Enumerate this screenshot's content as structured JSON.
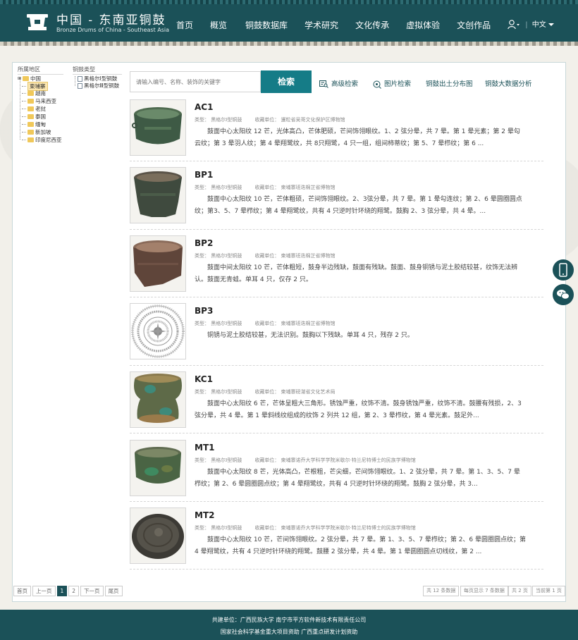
{
  "header": {
    "logo_cn": "中国 - 东南亚铜鼓",
    "logo_en": "Bronze Drums of China - Southeast Asia",
    "nav": [
      "首页",
      "概览",
      "铜鼓数据库",
      "学术研究",
      "文化传承",
      "虚拟体验",
      "文创作品"
    ],
    "lang": "中文"
  },
  "filters": {
    "region_title": "所属地区",
    "region_items": [
      {
        "label": "中国",
        "selected": false
      },
      {
        "label": "柬埔寨",
        "selected": true
      },
      {
        "label": "越南",
        "selected": false
      },
      {
        "label": "马来西亚",
        "selected": false
      },
      {
        "label": "老挝",
        "selected": false
      },
      {
        "label": "泰国",
        "selected": false
      },
      {
        "label": "缅甸",
        "selected": false
      },
      {
        "label": "新加坡",
        "selected": false
      },
      {
        "label": "印度尼西亚",
        "selected": false
      }
    ],
    "type_title": "铜鼓类型",
    "type_items": [
      "黑格尔Ⅰ型铜鼓",
      "黑格尔Ⅲ型铜鼓"
    ]
  },
  "search": {
    "placeholder": "请输入编号、名称、装饰的关键字",
    "button": "检索",
    "advanced": "高级检索",
    "image_search": "图片检索",
    "map": "铜鼓出土分布图",
    "bigdata": "铜鼓大数据分析"
  },
  "labels": {
    "type": "类型：",
    "collection": "收藏单位："
  },
  "results": [
    {
      "code": "AC1",
      "type": "黑格尔Ⅰ型铜鼓",
      "collection": "暹粒省吴哥文化保护区博物馆",
      "desc": "鼓面中心太阳纹 12 芒，光体高凸，芒体肥硕，芒间饰翎眼纹。1、2 弦分晕，共 7 晕。第 1 晕光素；第 2 晕勾云纹；第 3 晕羽人纹；第 4 晕翔鹭纹，共 8只翔鹭，4 只一组，组间柿蒂纹；第 5、7 晕栉纹；第 6 ..."
    },
    {
      "code": "BP1",
      "type": "黑格尔Ⅰ型铜鼓",
      "collection": "柬埔寨班迭棉芷省博物馆",
      "desc": "鼓面中心太阳纹 10 芒，芒体粗硕，芒间饰翎眼纹。2、3弦分晕，共 7 晕。第 1 晕勾连纹；第 2、6 晕圆圈圆点纹；第3、5、7 晕栉纹；第 4 晕翔鹭纹，共有 4 只逆时针环绕的翔鹭。鼓胸 2、3 弦分晕，共 4 晕。..."
    },
    {
      "code": "BP2",
      "type": "黑格尔Ⅰ型铜鼓",
      "collection": "柬埔寨班迭棉芷省博物馆",
      "desc": "鼓面中间太阳纹 10 芒，芒体粗短，鼓身半边残缺，鼓面有残缺。鼓面、鼓身铜锈与泥土胶结较甚，纹饰无法辨认。鼓面无青蛙。单耳 4 只，仅存 2 只。"
    },
    {
      "code": "BP3",
      "type": "黑格尔Ⅰ型铜鼓",
      "collection": "柬埔寨班迭棉芷省博物馆",
      "desc": "铜锈与泥土胶结较甚，无法识别。鼓胸以下残缺。单耳 4 只，残存 2 只。"
    },
    {
      "code": "KC1",
      "type": "黑格尔Ⅰ型铜鼓",
      "collection": "柬埔寨磅湛省文化艺术局",
      "desc": "鼓面中心太阳纹 6 芒，芒体呈粗大三角形。锈蚀严重，纹饰不清。鼓身锈蚀严重，纹饰不清。鼓腰有残损，2、3 弦分晕，共 4 晕。第 1 晕斜线纹组成的纹饰 2 列共 12 组，第 2、3 晕栉纹，第 4 晕光素。鼓足外..."
    },
    {
      "code": "MT1",
      "type": "黑格尔Ⅰ型铜鼓",
      "collection": "柬埔寨诺乔大学科学学院米歇尔·特兰尼特博士的民族学博物馆",
      "desc": "鼓面中心太阳纹 8 芒，光体高凸，芒根粗，芒尖细，芒间饰翎眼纹。1、2 弦分晕，共 7 晕。第 1、3、5、7 晕栉纹；第 2、6 晕圆圈圆点纹；第 4 晕翔鹭纹，共有 4 只逆时针环绕的翔鹭。鼓胸 2 弦分晕，共 3..."
    },
    {
      "code": "MT2",
      "type": "黑格尔Ⅰ型铜鼓",
      "collection": "柬埔寨诺乔大学科学学院米歇尔·特兰尼特博士的民族学博物馆",
      "desc": "鼓面中心太阳纹 10 芒，芒间饰翎眼纹。2 弦分晕，共 7 晕。第 1、3、5、7 晕栉纹；第 2、6 晕圆圈圆点纹；第 4 晕翔鹭纹，共有 4 只逆时针环绕的翔鹭。鼓腰 2 弦分晕，共 4 晕。第 1 晕圆圈圆点切线纹，第 2 ..."
    }
  ],
  "pager": {
    "first": "首页",
    "prev": "上一页",
    "pages": [
      "1",
      "2"
    ],
    "current": "1",
    "next": "下一页",
    "last": "尾页",
    "total": "共 12 条数据",
    "per_page": "每页显示 7 条数据",
    "total_pages": "共 2 页",
    "current_page": "当前第 1 页"
  },
  "footer": {
    "line1": "共建单位：广西民族大学  南宁市平方软件新技术有限责任公司",
    "line2": "国家社会科学基金重大项目资助    广西重点研发计划资助"
  },
  "colors": {
    "primary": "#1b5158",
    "accent": "#157c87"
  }
}
